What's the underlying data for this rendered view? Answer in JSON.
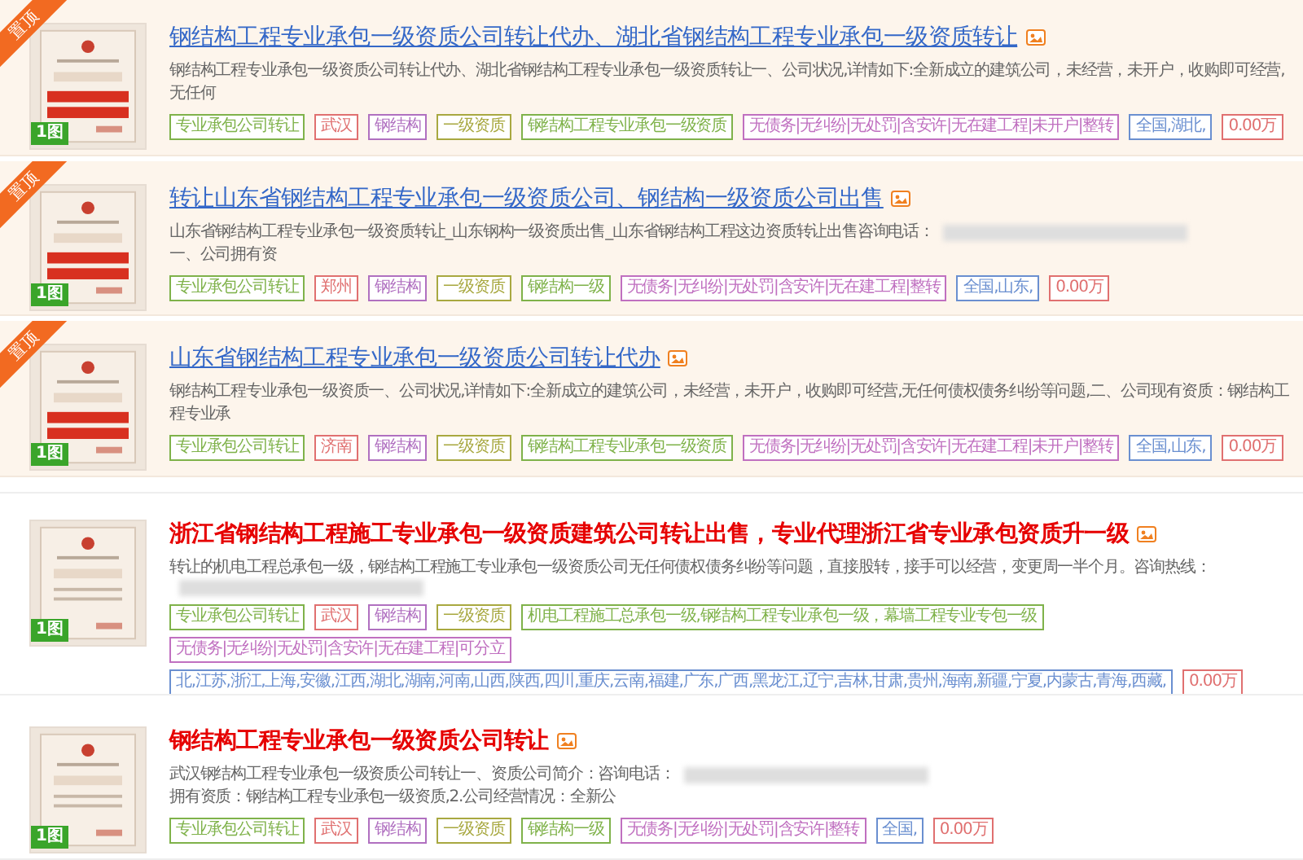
{
  "listings": [
    {
      "pinned": true,
      "ribbon": "置顶",
      "photo_count": "1图",
      "title": "钢结构工程专业承包一级资质公司转让代办、湖北省钢结构工程专业承包一级资质转让",
      "description": {
        "text": "钢结构工程专业承包一级资质公司转让代办、湖北省钢结构工程专业承包一级资质转让一、公司状况,详情如下:全新成立的建筑公司，未经营，未开户，收购即可经营,无任何"
      },
      "tags": [
        {
          "text": "专业承包公司转让",
          "color": "#7fb24a"
        },
        {
          "text": "武汉",
          "color": "#e07070"
        },
        {
          "text": "钢结构",
          "color": "#b070c0"
        },
        {
          "text": "一级资质",
          "color": "#a8a840"
        },
        {
          "text": "钢结构工程专业承包一级资质",
          "color": "#7fb24a"
        },
        {
          "text": "无债务|无纠纷|无处罚|含安许|无在建工程|未开户|整转",
          "color": "#c070c0"
        },
        {
          "text": "全国,湖北,",
          "color": "#6a8fd0"
        },
        {
          "text": "0.00万",
          "color": "#e07070"
        }
      ]
    },
    {
      "pinned": true,
      "ribbon": "置顶",
      "photo_count": "1图",
      "title": "转让山东省钢结构工程专业承包一级资质公司、钢结构一级资质公司出售",
      "description": {
        "text": "山东省钢结构工程专业承包一级资质转让_山东钢构一级资质出售_山东省钢结构工程这边资质转让出售咨询电话：",
        "redacted": true,
        "text_after": "一、公司拥有资"
      },
      "tags": [
        {
          "text": "专业承包公司转让",
          "color": "#7fb24a"
        },
        {
          "text": "郑州",
          "color": "#e07070"
        },
        {
          "text": "钢结构",
          "color": "#b070c0"
        },
        {
          "text": "一级资质",
          "color": "#a8a840"
        },
        {
          "text": "钢结构一级",
          "color": "#7fb24a"
        },
        {
          "text": "无债务|无纠纷|无处罚|含安许|无在建工程|整转",
          "color": "#c070c0"
        },
        {
          "text": "全国,山东,",
          "color": "#6a8fd0"
        },
        {
          "text": "0.00万",
          "color": "#e07070"
        }
      ]
    },
    {
      "pinned": true,
      "ribbon": "置顶",
      "photo_count": "1图",
      "title": "山东省钢结构工程专业承包一级资质公司转让代办",
      "description": {
        "text": "钢结构工程专业承包一级资质一、公司状况,详情如下:全新成立的建筑公司，未经营，未开户，收购即可经营,无任何债权债务纠纷等问题,二、公司现有资质：钢结构工程专业承"
      },
      "tags": [
        {
          "text": "专业承包公司转让",
          "color": "#7fb24a"
        },
        {
          "text": "济南",
          "color": "#e07070"
        },
        {
          "text": "钢结构",
          "color": "#b070c0"
        },
        {
          "text": "一级资质",
          "color": "#a8a840"
        },
        {
          "text": "钢结构工程专业承包一级资质",
          "color": "#7fb24a"
        },
        {
          "text": "无债务|无纠纷|无处罚|含安许|无在建工程|未开户|整转",
          "color": "#c070c0"
        },
        {
          "text": "全国,山东,",
          "color": "#6a8fd0"
        },
        {
          "text": "0.00万",
          "color": "#e07070"
        }
      ]
    },
    {
      "pinned": false,
      "photo_count": "1图",
      "title": "浙江省钢结构工程施工专业承包一级资质建筑公司转让出售，专业代理浙江省专业承包资质升一级",
      "description": {
        "text": "转让的机电工程总承包一级，钢结构工程施工专业承包一级资质公司无任何债权债务纠纷等问题，直接股转，接手可以经营，变更周一半个月。咨询热线：",
        "redacted": true
      },
      "tags": [
        {
          "text": "专业承包公司转让",
          "color": "#7fb24a"
        },
        {
          "text": "武汉",
          "color": "#e07070"
        },
        {
          "text": "钢结构",
          "color": "#b070c0"
        },
        {
          "text": "一级资质",
          "color": "#a8a840"
        },
        {
          "text": "机电工程施工总承包一级,钢结构工程专业承包一级，幕墙工程专业专包一级",
          "color": "#7fb24a"
        },
        {
          "text": "无债务|无纠纷|无处罚|含安许|无在建工程|可分立",
          "color": "#c070c0"
        },
        {
          "text": "北,江苏,浙江,上海,安徽,江西,湖北,湖南,河南,山西,陕西,四川,重庆,云南,福建,广东,广西,黑龙江,辽宁,吉林,甘肃,贵州,海南,新疆,宁夏,内蒙古,青海,西藏,",
          "color": "#6a8fd0"
        },
        {
          "text": "0.00万",
          "color": "#e07070"
        }
      ]
    },
    {
      "pinned": false,
      "photo_count": "1图",
      "title": "钢结构工程专业承包一级资质公司转让",
      "description": {
        "text": "武汉钢结构工程专业承包一级资质公司转让一、资质公司简介：咨询电话：",
        "redacted": true,
        "text_after": "拥有资质：钢结构工程专业承包一级资质,2.公司经营情况：全新公"
      },
      "tags": [
        {
          "text": "专业承包公司转让",
          "color": "#7fb24a"
        },
        {
          "text": "武汉",
          "color": "#e07070"
        },
        {
          "text": "钢结构",
          "color": "#b070c0"
        },
        {
          "text": "一级资质",
          "color": "#a8a840"
        },
        {
          "text": "钢结构一级",
          "color": "#7fb24a"
        },
        {
          "text": "无债务|无纠纷|无处罚|含安许|整转",
          "color": "#c070c0"
        },
        {
          "text": "全国,",
          "color": "#6a8fd0"
        },
        {
          "text": "0.00万",
          "color": "#e07070"
        }
      ]
    }
  ]
}
